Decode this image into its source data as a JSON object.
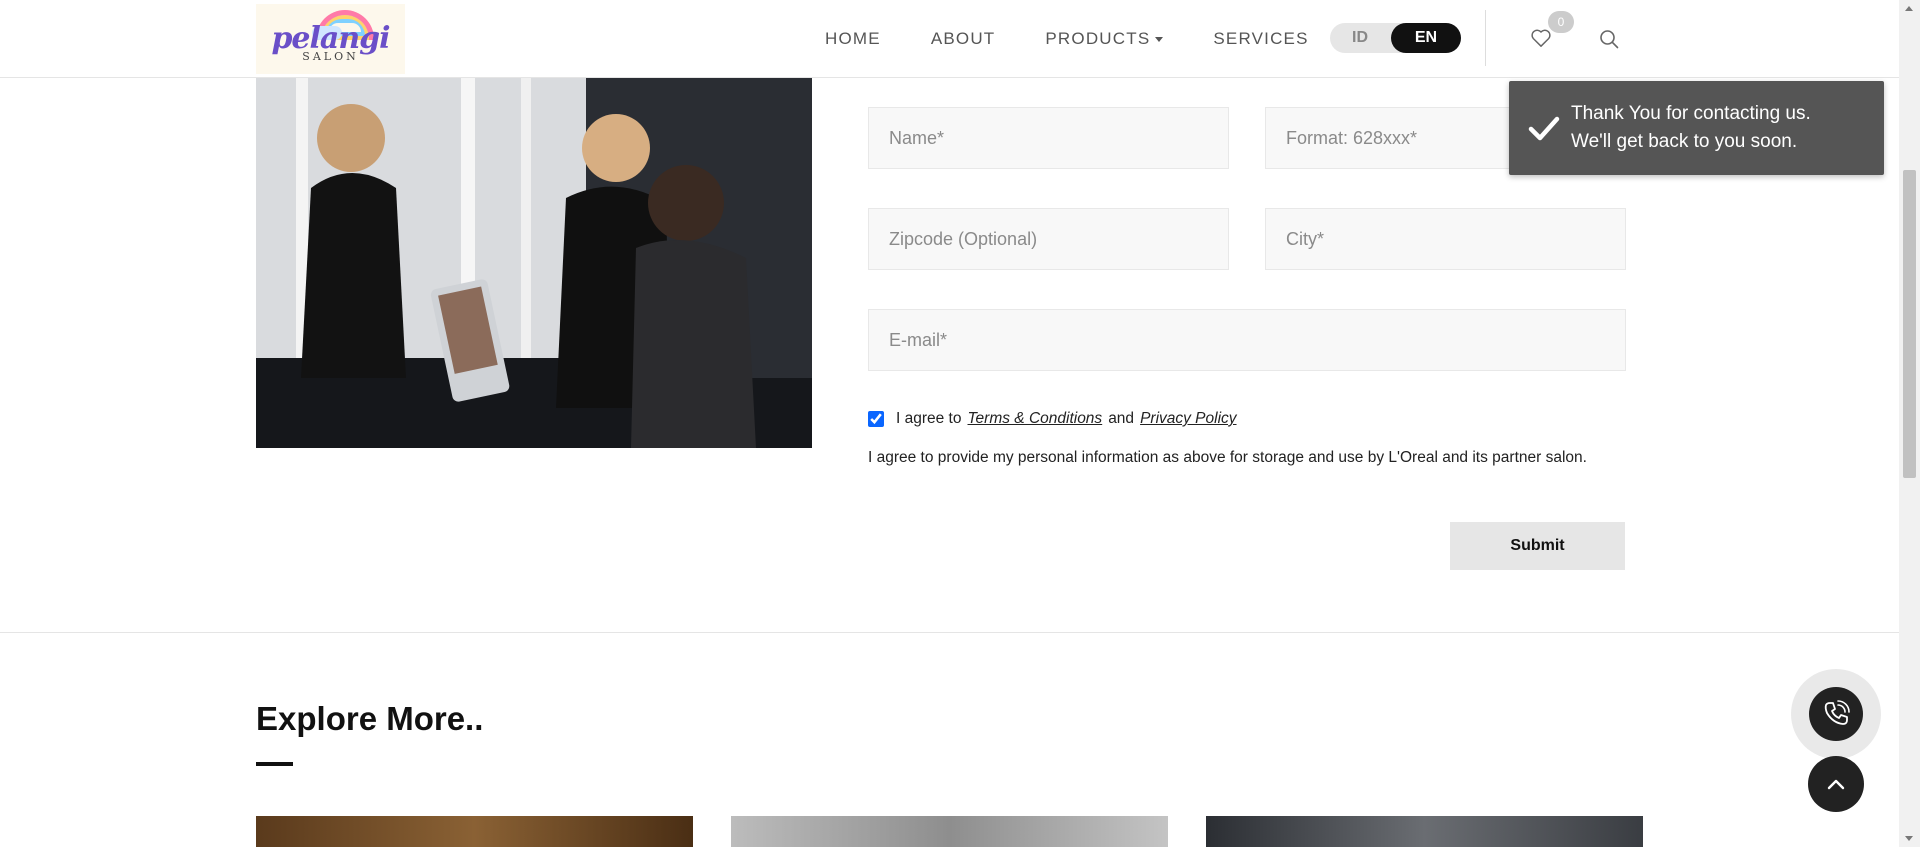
{
  "brand": {
    "name": "pelangi",
    "sub": "SALON"
  },
  "nav": {
    "items": [
      {
        "label": "HOME"
      },
      {
        "label": "ABOUT"
      },
      {
        "label": "PRODUCTS",
        "has_caret": true
      },
      {
        "label": "SERVICES"
      }
    ],
    "lang": {
      "options": [
        "ID",
        "EN"
      ],
      "selected": "EN"
    },
    "wishlist_count": "0"
  },
  "form": {
    "name_placeholder": "Name*",
    "phone_placeholder": "Format: 628xxx*",
    "zip_placeholder": "Zipcode (Optional)",
    "city_placeholder": "City*",
    "email_placeholder": "E-mail*",
    "agree_prefix": "I agree to",
    "terms_label": "Terms & Conditions",
    "and_label": "and",
    "privacy_label": "Privacy Policy",
    "consent_text": "I agree to provide my personal information as above for storage and use by L'Oreal and its partner salon.",
    "submit_label": "Submit",
    "agree_checked": true
  },
  "explore": {
    "title": "Explore More.."
  },
  "toast": {
    "line1": "Thank You for contacting us.",
    "line2": "We'll get back to you soon."
  },
  "colors": {
    "accent": "#111111",
    "toast_bg": "#555555",
    "checkbox": "#0a66ff"
  }
}
